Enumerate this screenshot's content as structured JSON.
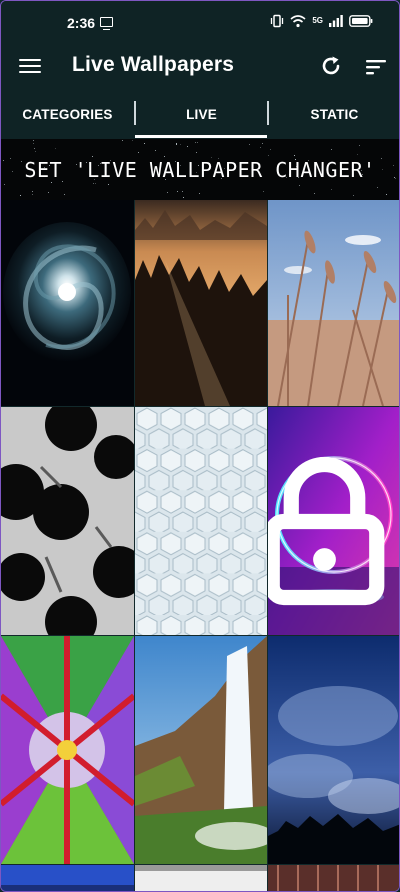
{
  "status_bar": {
    "time": "2:36",
    "network_label": "5G"
  },
  "app_bar": {
    "title": "Live Wallpapers"
  },
  "tabs": [
    {
      "label": "CATEGORIES",
      "selected": false
    },
    {
      "label": "LIVE",
      "selected": true
    },
    {
      "label": "STATIC",
      "selected": false
    }
  ],
  "banner": {
    "text": "SET 'LIVE WALLPAPER CHANGER'"
  },
  "wallpapers": [
    {
      "subject": "spiral galaxy",
      "locked": false
    },
    {
      "subject": "misty forest sunrise",
      "locked": false
    },
    {
      "subject": "wheat field sky",
      "locked": false
    },
    {
      "subject": "black ink blots",
      "locked": false
    },
    {
      "subject": "white hexagon pattern",
      "locked": false
    },
    {
      "subject": "neon ring",
      "locked": true
    },
    {
      "subject": "kaleidoscope",
      "locked": false
    },
    {
      "subject": "waterfall cliff",
      "locked": false
    },
    {
      "subject": "night clouds",
      "locked": false
    }
  ],
  "colors": {
    "toolbar_bg": "#0f2325",
    "accent_frame": "#7e57c2",
    "banner_bg": "#050607"
  }
}
